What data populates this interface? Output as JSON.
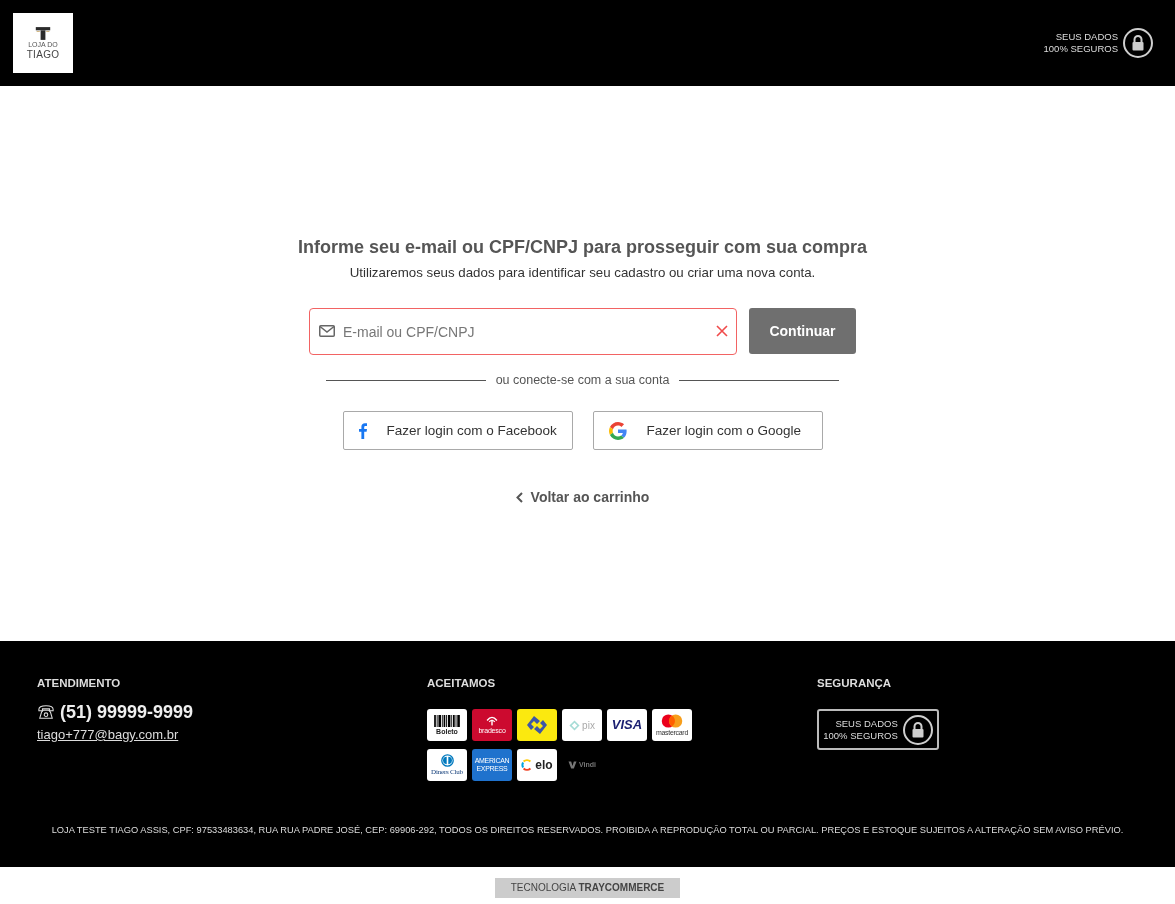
{
  "header": {
    "logo": {
      "line_1": "LOJA DO",
      "line_2": "TIAGO"
    },
    "security_badge": {
      "line_1": "SEUS DADOS",
      "line_2": "100% SEGUROS"
    }
  },
  "login": {
    "title": "Informe seu e-mail ou CPF/CNPJ para prosseguir com sua compra",
    "subtitle": "Utilizaremos seus dados para identificar seu cadastro ou criar uma nova conta.",
    "email_field": {
      "placeholder": "E-mail ou CPF/CNPJ",
      "invalid": true
    },
    "continue_button": "Continuar",
    "divider_text": "ou conecte-se com a sua conta",
    "social_buttons": [
      {
        "kind": "facebook",
        "label": "Fazer login com o Facebook"
      },
      {
        "kind": "google",
        "label": "Fazer login com o Google"
      }
    ],
    "back_link": "Voltar ao carrinho"
  },
  "footer": {
    "service": {
      "heading": "ATENDIMENTO",
      "phone": "(51) 99999-9999",
      "email": "tiago+777@bagy.com.br"
    },
    "payments": {
      "heading": "ACEITAMOS",
      "methods": [
        {
          "kind": "boleto",
          "label": "Boleto"
        },
        {
          "kind": "bradesco",
          "label": "bradesco"
        },
        {
          "kind": "banco_do_brasil"
        },
        {
          "kind": "pix",
          "label": "pix"
        },
        {
          "kind": "visa",
          "label": "VISA"
        },
        {
          "kind": "mastercard",
          "label": "mastercard"
        },
        {
          "kind": "diners",
          "label": "Diners Club"
        },
        {
          "kind": "amex",
          "label": "AMERICAN EXPRESS"
        },
        {
          "kind": "elo",
          "label": "elo"
        },
        {
          "kind": "vindi",
          "label": "Vindi"
        }
      ]
    },
    "security": {
      "heading": "SEGURANÇA",
      "badge": {
        "line_1": "SEUS DADOS",
        "line_2": "100% SEGUROS"
      }
    },
    "legal_text": "LOJA TESTE TIAGO ASSIS, CPF: 97533483634, RUA RUA PADRE JOSÉ, CEP: 69906-292, TODOS OS DIREITOS RESERVADOS. PROIBIDA A REPRODUÇÃO TOTAL OU PARCIAL. PREÇOS E ESTOQUE SUJEITOS A ALTERAÇÃO SEM AVISO PRÉVIO.",
    "platform_credit": "TECNOLOGIA **TRAYCOMMERCE**"
  }
}
